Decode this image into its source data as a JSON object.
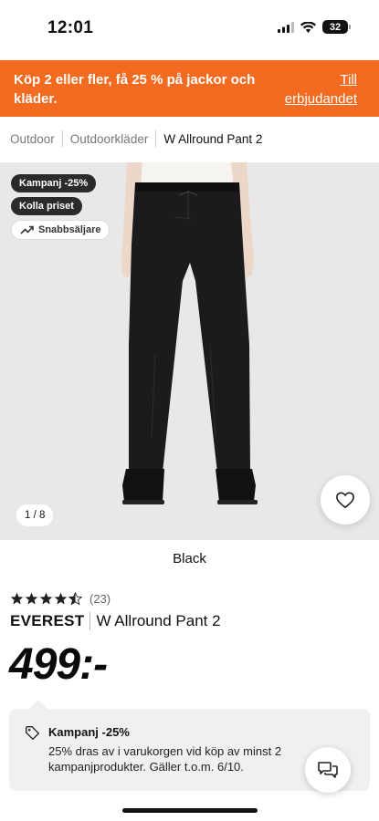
{
  "status_bar": {
    "time": "12:01",
    "battery": "32"
  },
  "promo": {
    "text": "Köp 2 eller fler, få 25 % på jackor och kläder.",
    "link_line1": "Till",
    "link_line2": "erbjudandet"
  },
  "breadcrumb": [
    "Outdoor",
    "Outdoorkläder",
    "W Allround Pant 2"
  ],
  "badges": {
    "campaign": "Kampanj -25%",
    "check_price": "Kolla priset",
    "fast_seller": "Snabbsäljare"
  },
  "image_counter": "1 / 8",
  "color": "Black",
  "rating": {
    "stars": 4.5,
    "count": "(23)"
  },
  "product": {
    "brand": "EVEREST",
    "name": "W Allround Pant 2",
    "price": "499:-"
  },
  "campaign_box": {
    "title": "Kampanj -25%",
    "description": "25% dras av i varukorgen vid köp av minst 2 kampanjprodukter. Gäller t.o.m. 6/10."
  },
  "colors": {
    "promo_orange": "#f26b21",
    "badge_dark": "#2b2b2b",
    "image_bg": "#e8e8e8"
  },
  "icons": [
    "signal-icon",
    "wifi-icon",
    "battery-icon",
    "trend-icon",
    "heart-icon",
    "star-icon",
    "tag-icon",
    "chat-icon"
  ]
}
